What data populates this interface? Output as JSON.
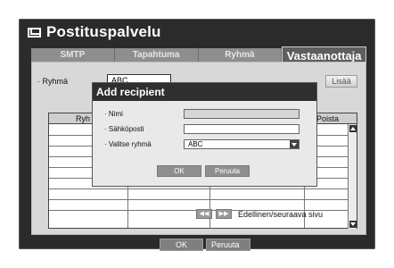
{
  "window": {
    "title": "Postituspalvelu"
  },
  "tabs": [
    {
      "label": "SMTP",
      "active": false
    },
    {
      "label": "Tapahtuma",
      "active": false
    },
    {
      "label": "Ryhmä",
      "active": false
    },
    {
      "label": "Vastaanottaja",
      "active": true
    }
  ],
  "filter": {
    "group_label": "· Ryhmä",
    "group_value": "ABC",
    "add_label": "Lisää"
  },
  "table": {
    "col_name_partial": "Ryh",
    "col_delete": "Poista"
  },
  "pager": {
    "prev_symbol": "◀◀",
    "next_symbol": "▶▶",
    "text": "Edellinen/seuraava sivu"
  },
  "footer": {
    "ok_label": "OK",
    "cancel_label": "Peruuta"
  },
  "modal": {
    "title": "Add recipient",
    "name_label": "· Nimi",
    "name_value": "",
    "email_label": "· Sähköposti",
    "email_value": "",
    "group_label": "· Valitse ryhmä",
    "group_value": "ABC",
    "ok_label": "OK",
    "cancel_label": "Peruuta"
  },
  "colors": {
    "frame_bg": "#2b2b2b",
    "panel_bg": "#d8d8d8",
    "tab_active": "#5e5e5e",
    "header_bar": "#2f2f2f"
  },
  "icons": {
    "title_icon": "envelope-icon"
  }
}
